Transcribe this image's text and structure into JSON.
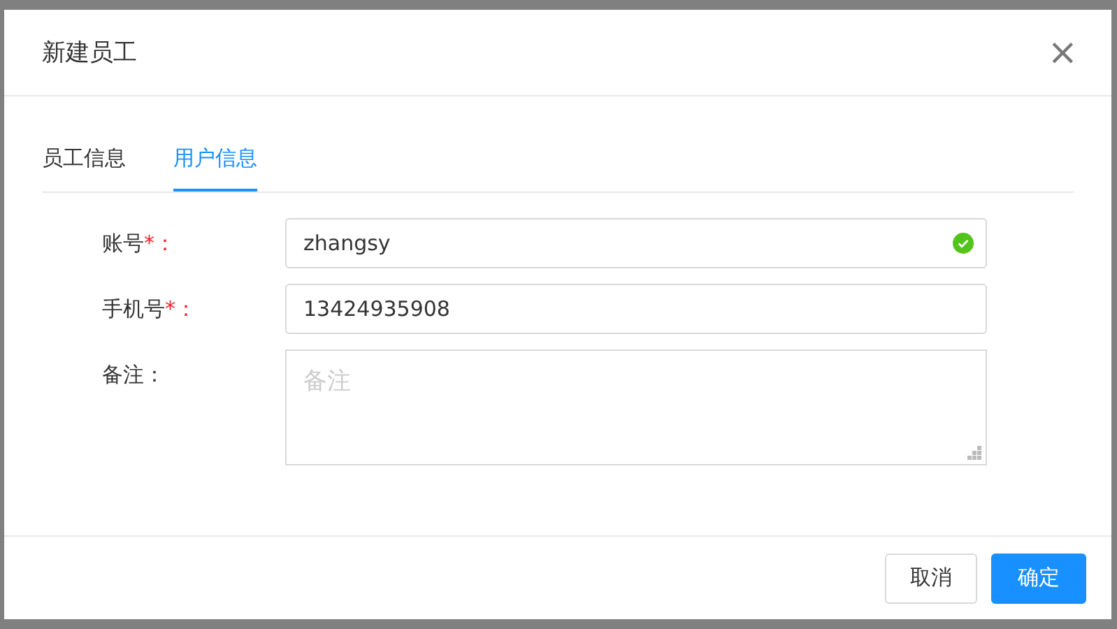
{
  "dialog": {
    "title": "新建员工",
    "close": "×"
  },
  "tabs": [
    {
      "label": "员工信息",
      "selected": false
    },
    {
      "label": "用户信息",
      "selected": true
    }
  ],
  "fields": [
    {
      "kind": "input",
      "label": "账号",
      "required_mark": "*：",
      "value": "zhangsy",
      "valid": true
    },
    {
      "kind": "input",
      "label": "手机号",
      "required_mark": "*：",
      "value": "13424935908",
      "valid": false
    },
    {
      "kind": "textarea",
      "label": "备注：",
      "placeholder": "备注"
    }
  ],
  "buttons": [
    {
      "label": "取消",
      "primary": false
    },
    {
      "label": "确定",
      "primary": true
    }
  ]
}
